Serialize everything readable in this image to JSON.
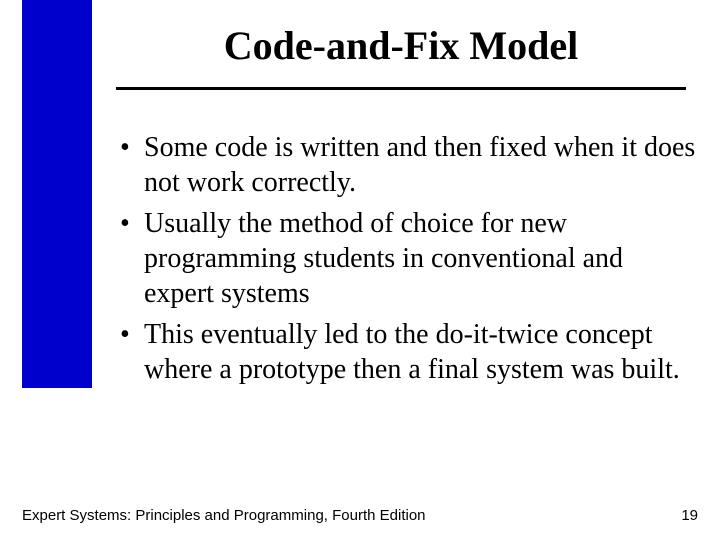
{
  "title": "Code-and-Fix Model",
  "bullets": [
    "Some code is written and then fixed when it does not work correctly.",
    "Usually the method of choice for new programming students in conventional and expert systems",
    "This eventually led to the do-it-twice concept where a prototype then a final system was built."
  ],
  "footer": {
    "left": "Expert Systems: Principles and Programming, Fourth Edition",
    "right": "19"
  }
}
